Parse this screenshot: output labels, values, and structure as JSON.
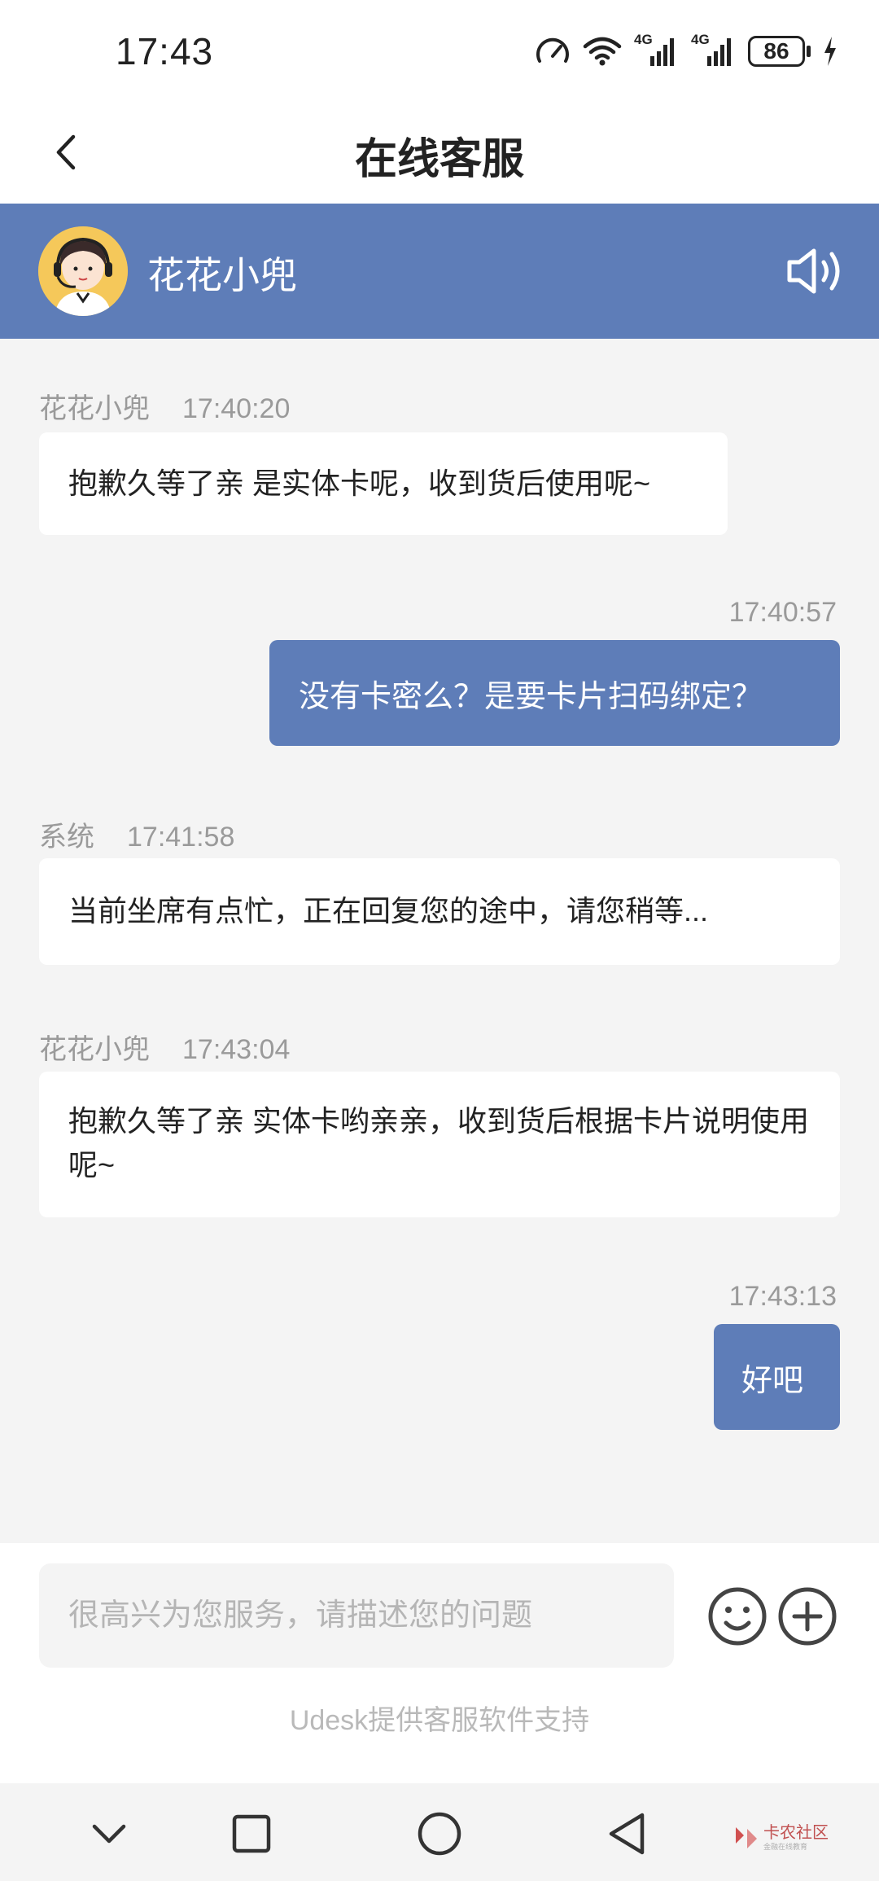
{
  "status_bar": {
    "time": "17:43",
    "battery": "86",
    "network_label_1": "4G",
    "network_label_2": "4G"
  },
  "header": {
    "title": "在线客服"
  },
  "agent": {
    "name": "花花小兜"
  },
  "messages": [
    {
      "side": "left",
      "sender": "花花小兜",
      "time": "17:40:20",
      "text": "抱歉久等了亲 是实体卡呢，收到货后使用呢~"
    },
    {
      "side": "right",
      "time": "17:40:57",
      "text": "没有卡密么？是要卡片扫码绑定？"
    },
    {
      "side": "left",
      "sender": "系统",
      "time": "17:41:58",
      "text": "当前坐席有点忙，正在回复您的途中，请您稍等..."
    },
    {
      "side": "left",
      "sender": "花花小兜",
      "time": "17:43:04",
      "text": "抱歉久等了亲 实体卡哟亲亲，收到货后根据卡片说明使用呢~"
    },
    {
      "side": "right",
      "time": "17:43:13",
      "text": "好吧"
    }
  ],
  "input": {
    "placeholder": "很高兴为您服务，请描述您的问题",
    "value": ""
  },
  "footer": {
    "powered_by": "Udesk提供客服软件支持"
  },
  "watermark": {
    "text": "卡农社区",
    "subtext": "金融在线教育"
  },
  "colors": {
    "accent": "#5e7db8",
    "background": "#f4f4f4",
    "meta_text": "#9a9a9a"
  },
  "icons": [
    "back-arrow-icon",
    "speaker-icon",
    "emoji-icon",
    "plus-icon",
    "nav-down-icon",
    "nav-recent-icon",
    "nav-home-icon",
    "nav-back-icon"
  ]
}
